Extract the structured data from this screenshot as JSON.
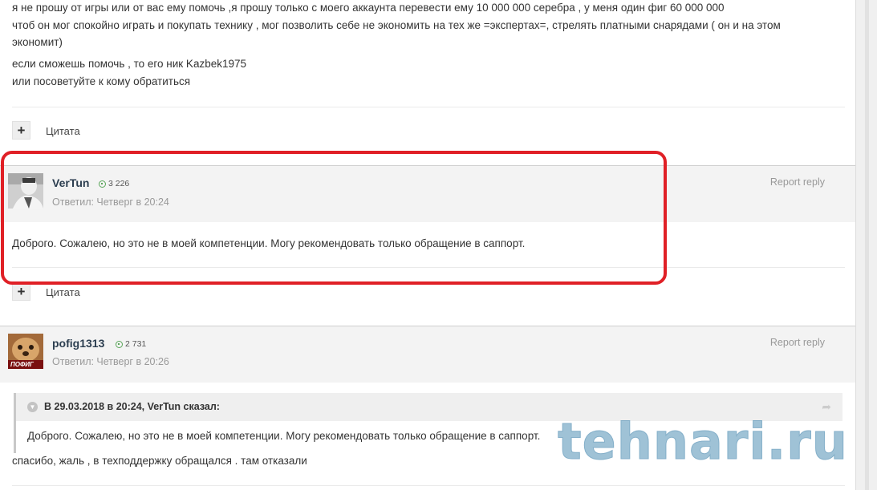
{
  "post1": {
    "lines": [
      "я не прошу от игры или от вас ему помочь ,я прошу только с моего аккаунта перевести ему 10 000 000 серебра , у меня один фиг 60 000 000",
      "чтоб он мог спокойно играть и покупать технику , мог позволить себе не экономить на тех же =экспертах=, стрелять платными снарядами ( он и на этом",
      "экономит)",
      "если сможешь помочь , то его ник  Kazbek1975",
      "или посоветуйте к кому обратиться"
    ],
    "quote_label": "Цитата"
  },
  "post2": {
    "author": "VerTun",
    "reputation": "3 226",
    "meta": "Ответил: Четверг в 20:24",
    "report": "Report reply",
    "body": "Доброго. Сожалею, но это не в моей компетенции. Могу рекомендовать только обращение в саппорт.",
    "quote_label": "Цитата",
    "highlight_color": "#e02026"
  },
  "post3": {
    "author": "pofig1313",
    "avatar_text": "ПОФИГ",
    "reputation": "2 731",
    "meta": "Ответил: Четверг в 20:26",
    "report": "Report reply",
    "quote": {
      "title": "В 29.03.2018 в 20:24, VerTun сказал:",
      "text": "Доброго. Сожалею, но это не в моей компетенции. Могу рекомендовать только обращение в саппорт."
    },
    "body": "спасибо, жаль , в техподдержку обращался . там отказали"
  },
  "watermark": "tehnari.ru"
}
